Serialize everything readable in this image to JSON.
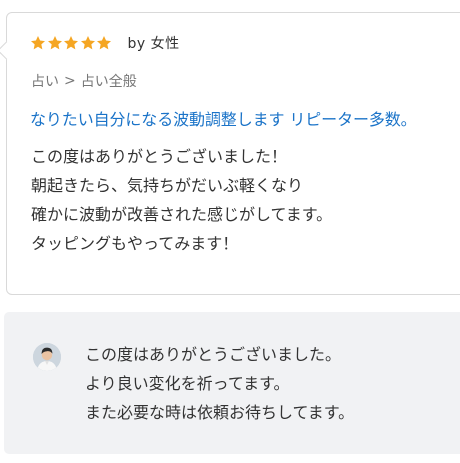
{
  "review": {
    "rating": 5,
    "rating_max": 5,
    "star_color": "#f5a623",
    "reviewer": "by 女性",
    "category": {
      "parent": "占い",
      "separator": ">",
      "child": "占い全般"
    },
    "service_title": "なりたい自分になる波動調整します リピーター多数。",
    "body_lines": [
      "この度はありがとうございました！",
      "朝起きたら、気持ちがだいぶ軽くなり",
      "確かに波動が改善された感じがしてます。",
      "タッピングもやってみます！"
    ]
  },
  "reply": {
    "avatar_icon": "seller-avatar",
    "body_lines": [
      "この度はありがとうございました。",
      "より良い変化を祈ってます。",
      "また必要な時は依頼お待ちしてます。"
    ]
  },
  "colors": {
    "link": "#1a73c8",
    "text": "#333333",
    "muted": "#777777",
    "reply_bg": "#f1f2f4",
    "border": "#d9d9d9"
  }
}
